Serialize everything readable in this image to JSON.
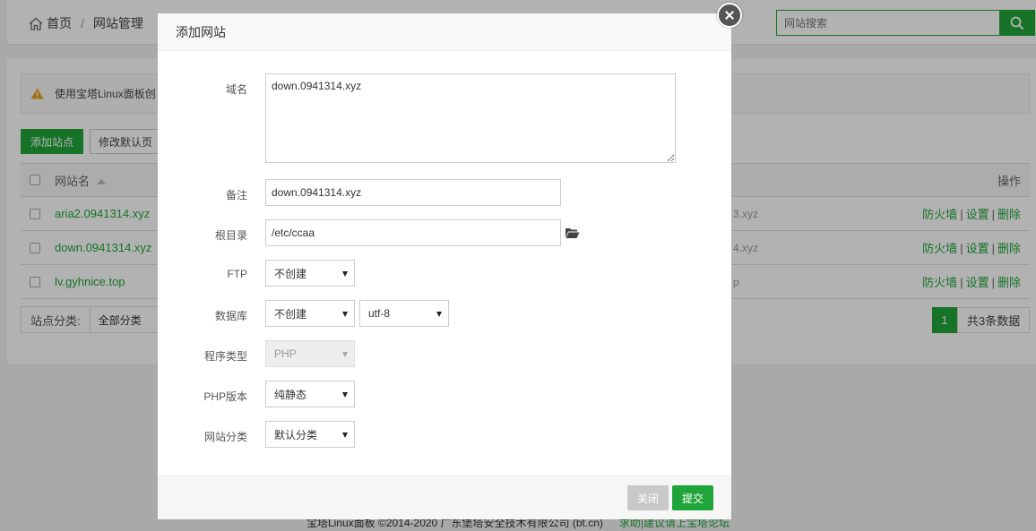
{
  "breadcrumb": {
    "home": "首页",
    "separator": "/",
    "current": "网站管理"
  },
  "search": {
    "placeholder": "网站搜索",
    "value": ""
  },
  "notice": {
    "text": "使用宝塔Linux面板创"
  },
  "actions": {
    "add_site": "添加站点",
    "modify_default": "修改默认页"
  },
  "table": {
    "headers": {
      "name": "网站名",
      "ops": "操作"
    },
    "rows": [
      {
        "name": "aria2.0941314.xyz",
        "remark": "3.xyz",
        "ops": [
          "防火墙",
          "设置",
          "删除"
        ]
      },
      {
        "name": "down.0941314.xyz",
        "remark": "4.xyz",
        "ops": [
          "防火墙",
          "设置",
          "删除"
        ]
      },
      {
        "name": "lv.gyhnice.top",
        "remark": "p",
        "ops": [
          "防火墙",
          "设置",
          "删除"
        ]
      }
    ],
    "op_separator": "|"
  },
  "category": {
    "label": "站点分类:",
    "value": "全部分类"
  },
  "pager": {
    "current": "1",
    "total": "共3条数据"
  },
  "footer": {
    "copyright": "宝塔Linux面板 ©2014-2020 广东堡塔安全技术有限公司 (bt.cn)",
    "help": "求助|建议请上宝塔论坛"
  },
  "modal": {
    "title": "添加网站",
    "fields": {
      "domain_label": "域名",
      "domain_value": "down.0941314.xyz",
      "remark_label": "备注",
      "remark_value": "down.0941314.xyz",
      "root_label": "根目录",
      "root_value": "/etc/ccaa",
      "ftp_label": "FTP",
      "ftp_value": "不创建",
      "db_label": "数据库",
      "db_value": "不创建",
      "charset_value": "utf-8",
      "type_label": "程序类型",
      "type_value": "PHP",
      "php_label": "PHP版本",
      "php_value": "纯静态",
      "cat_label": "网站分类",
      "cat_value": "默认分类"
    },
    "buttons": {
      "close": "关闭",
      "submit": "提交"
    }
  },
  "colors": {
    "brand_green": "#20a53a",
    "overlay": "rgba(0,0,0,0.30)"
  },
  "icons": [
    "home-icon",
    "search-icon",
    "warning-icon",
    "sort-up-icon",
    "folder-open-icon",
    "close-icon",
    "chevron-down-icon"
  ]
}
